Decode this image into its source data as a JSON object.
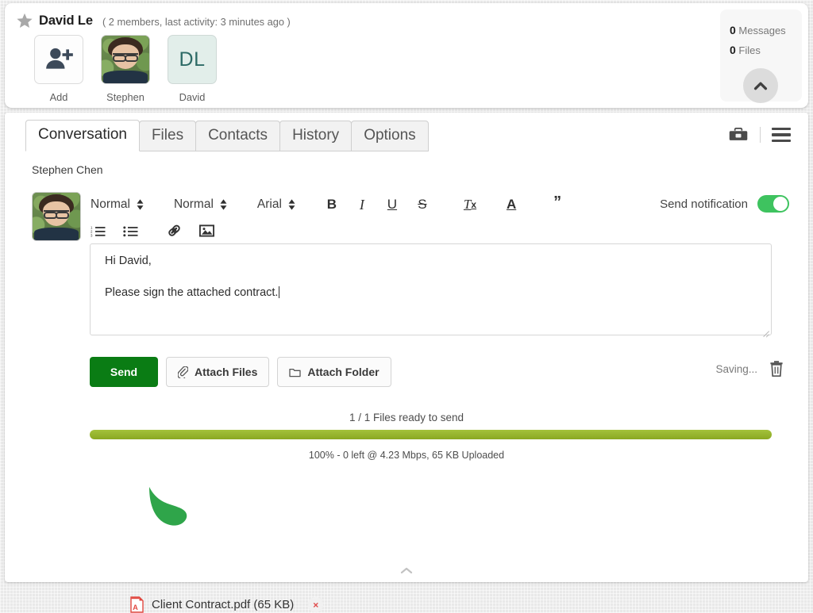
{
  "conversation": {
    "star_icon": "star-icon",
    "name": "David Le",
    "meta": "( 2 members, last activity: 3 minutes ago )",
    "members": [
      {
        "label": "Add",
        "type": "add",
        "initials": ""
      },
      {
        "label": "Stephen",
        "type": "photo",
        "initials": ""
      },
      {
        "label": "David",
        "type": "initials",
        "initials": "DL"
      }
    ],
    "counters": {
      "messages_count": "0",
      "messages_label": "Messages",
      "files_count": "0",
      "files_label": "Files",
      "collapse_icon": "chevron-up-icon"
    }
  },
  "tabs": [
    {
      "label": "Conversation",
      "active": true
    },
    {
      "label": "Files",
      "active": false
    },
    {
      "label": "Contacts",
      "active": false
    },
    {
      "label": "History",
      "active": false
    },
    {
      "label": "Options",
      "active": false
    }
  ],
  "panel_tools": {
    "toolbox_icon": "toolbox-icon",
    "menu_icon": "hamburger-menu-icon"
  },
  "composer": {
    "sender_name": "Stephen Chen",
    "toolbar": {
      "style_select": "Normal",
      "size_select": "Normal",
      "font_select": "Arial",
      "bold": "B",
      "italic": "I",
      "underline": "U",
      "strike": "S",
      "clear_format": "T",
      "clear_format_sub": "x",
      "text_color": "A",
      "blockquote": "”",
      "ordered_list_icon": "ordered-list-icon",
      "bullet_list_icon": "bullet-list-icon",
      "link_icon": "link-icon",
      "image_icon": "image-icon"
    },
    "notification": {
      "label": "Send notification",
      "enabled": true,
      "accent": "#3ec35f"
    },
    "message": {
      "line1": "Hi David,",
      "line2": "Please sign the attached contract."
    }
  },
  "actions": {
    "send_label": "Send",
    "send_color": "#0a7c14",
    "attach_files_label": "Attach Files",
    "attach_files_icon": "paperclip-icon",
    "attach_folder_label": "Attach Folder",
    "attach_folder_icon": "folder-icon",
    "saving_text": "Saving...",
    "trash_icon": "trash-icon"
  },
  "upload": {
    "status": "1 / 1 Files ready to send",
    "progress_percent": 100,
    "progress_color": "#95b32c",
    "detail": "100% - 0 left @ 4.23 Mbps, 65 KB Uploaded"
  },
  "attachments": [
    {
      "icon": "pdf-file-icon",
      "name": "Client Contract.pdf (65 KB)",
      "remove_label": "×"
    }
  ],
  "footer": {
    "collapse_icon": "chevron-up-icon"
  }
}
